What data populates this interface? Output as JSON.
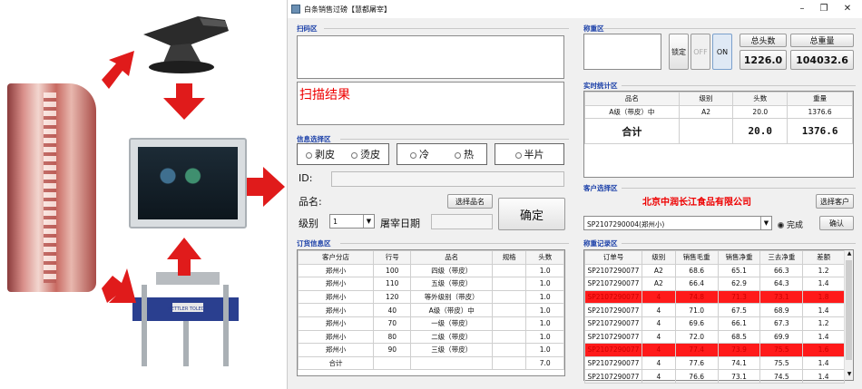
{
  "window": {
    "title": "白条销售过磅【慧都屠宰】",
    "min_icon": "minimize-icon",
    "max_icon": "restore-icon",
    "close_icon": "close-icon"
  },
  "scan": {
    "section": "扫码区",
    "result_text": "扫描结果"
  },
  "info": {
    "section": "信息选择区",
    "group1": [
      "剥皮",
      "烫皮"
    ],
    "group2": [
      "冷",
      "热"
    ],
    "group3": [
      "半片"
    ],
    "id_label": "ID:",
    "product_label": "品名:",
    "select_product_btn": "选择品名",
    "confirm_btn": "确定",
    "grade_label": "级别",
    "grade_value": "1",
    "slaughter_date_label": "屠宰日期"
  },
  "order": {
    "section": "订货信息区",
    "headers": [
      "客户分店",
      "行号",
      "品名",
      "规格",
      "头数"
    ],
    "rows": [
      [
        "郑州小",
        "100",
        "四级（带皮）",
        "",
        "1.0"
      ],
      [
        "郑州小",
        "110",
        "五级（带皮）",
        "",
        "1.0"
      ],
      [
        "郑州小",
        "120",
        "等外级别（带皮）",
        "",
        "1.0"
      ],
      [
        "郑州小",
        "40",
        "A级（带皮）中",
        "",
        "1.0"
      ],
      [
        "郑州小",
        "70",
        "一级（带皮）",
        "",
        "1.0"
      ],
      [
        "郑州小",
        "80",
        "二级（带皮）",
        "",
        "1.0"
      ],
      [
        "郑州小",
        "90",
        "三级（带皮）",
        "",
        "1.0"
      ],
      [
        "合计",
        "",
        "",
        "",
        "7.0"
      ]
    ]
  },
  "weigh": {
    "section": "称重区",
    "lock_btn": "锁定",
    "off_btn": "OFF",
    "on_btn": "ON",
    "total_heads_label": "总头数",
    "total_weight_label": "总重量",
    "total_heads": "1226.0",
    "total_weight": "104032.6"
  },
  "stats": {
    "section": "实时统计区",
    "headers": [
      "品名",
      "级别",
      "头数",
      "重量"
    ],
    "row": [
      "A级（带皮）中",
      "A2",
      "20.0",
      "1376.6"
    ],
    "total_label": "合计",
    "total_heads": "20.0",
    "total_weight": "1376.6"
  },
  "customer": {
    "section": "客户选择区",
    "name": "北京中润长江食品有限公司",
    "select_btn": "选择客户",
    "order_select": "SP2107290004(郑州小)",
    "done_label": "完成",
    "ok_btn": "确认"
  },
  "records": {
    "section": "称重记录区",
    "headers": [
      "订单号",
      "级别",
      "销售毛重",
      "销售净重",
      "三去净重",
      "差额"
    ],
    "rows": [
      [
        "SP2107290077",
        "A2",
        "68.6",
        "65.1",
        "66.3",
        "1.2"
      ],
      [
        "SP2107290077",
        "A2",
        "66.4",
        "62.9",
        "64.3",
        "1.4"
      ],
      [
        "SP2107290077",
        "4",
        "74.8",
        "71.3",
        "73.1",
        "1.8"
      ],
      [
        "SP2107290077",
        "4",
        "71.0",
        "67.5",
        "68.9",
        "1.4"
      ],
      [
        "SP2107290077",
        "4",
        "69.6",
        "66.1",
        "67.3",
        "1.2"
      ],
      [
        "SP2107290077",
        "4",
        "72.0",
        "68.5",
        "69.9",
        "1.4"
      ],
      [
        "SP2107290077",
        "4",
        "77.4",
        "73.9",
        "75.5",
        "1.6"
      ],
      [
        "SP2107290077",
        "4",
        "77.6",
        "74.1",
        "75.5",
        "1.4"
      ],
      [
        "SP2107290077",
        "4",
        "76.6",
        "73.1",
        "74.5",
        "1.4"
      ]
    ],
    "highlight_rows": [
      2,
      6
    ],
    "highlight_color": "#ff1a1a"
  },
  "illustration": {
    "brand_on_scale": "METTLER TOLEDO",
    "arrow_color": "#e01b1b"
  }
}
